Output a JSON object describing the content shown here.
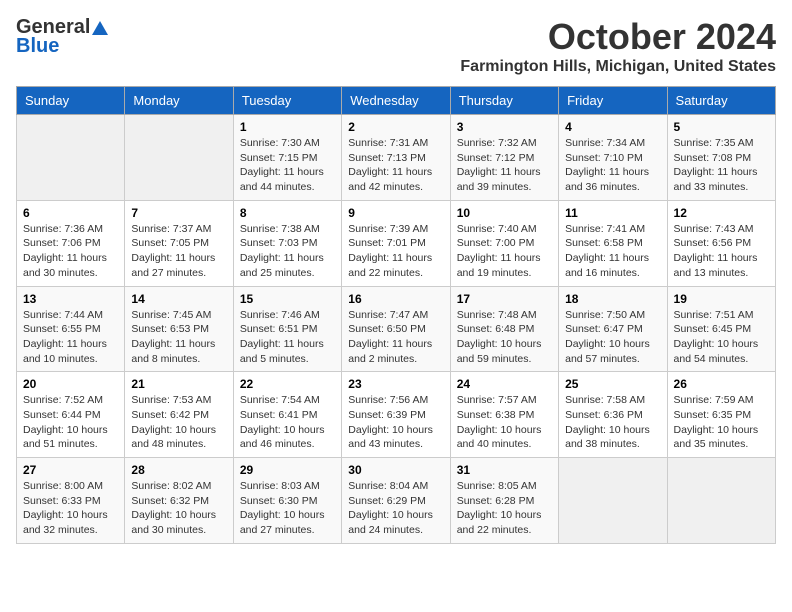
{
  "logo": {
    "general": "General",
    "blue": "Blue"
  },
  "title": "October 2024",
  "location": "Farmington Hills, Michigan, United States",
  "days_header": [
    "Sunday",
    "Monday",
    "Tuesday",
    "Wednesday",
    "Thursday",
    "Friday",
    "Saturday"
  ],
  "weeks": [
    [
      {
        "day": "",
        "info": ""
      },
      {
        "day": "",
        "info": ""
      },
      {
        "day": "1",
        "info": "Sunrise: 7:30 AM\nSunset: 7:15 PM\nDaylight: 11 hours and 44 minutes."
      },
      {
        "day": "2",
        "info": "Sunrise: 7:31 AM\nSunset: 7:13 PM\nDaylight: 11 hours and 42 minutes."
      },
      {
        "day": "3",
        "info": "Sunrise: 7:32 AM\nSunset: 7:12 PM\nDaylight: 11 hours and 39 minutes."
      },
      {
        "day": "4",
        "info": "Sunrise: 7:34 AM\nSunset: 7:10 PM\nDaylight: 11 hours and 36 minutes."
      },
      {
        "day": "5",
        "info": "Sunrise: 7:35 AM\nSunset: 7:08 PM\nDaylight: 11 hours and 33 minutes."
      }
    ],
    [
      {
        "day": "6",
        "info": "Sunrise: 7:36 AM\nSunset: 7:06 PM\nDaylight: 11 hours and 30 minutes."
      },
      {
        "day": "7",
        "info": "Sunrise: 7:37 AM\nSunset: 7:05 PM\nDaylight: 11 hours and 27 minutes."
      },
      {
        "day": "8",
        "info": "Sunrise: 7:38 AM\nSunset: 7:03 PM\nDaylight: 11 hours and 25 minutes."
      },
      {
        "day": "9",
        "info": "Sunrise: 7:39 AM\nSunset: 7:01 PM\nDaylight: 11 hours and 22 minutes."
      },
      {
        "day": "10",
        "info": "Sunrise: 7:40 AM\nSunset: 7:00 PM\nDaylight: 11 hours and 19 minutes."
      },
      {
        "day": "11",
        "info": "Sunrise: 7:41 AM\nSunset: 6:58 PM\nDaylight: 11 hours and 16 minutes."
      },
      {
        "day": "12",
        "info": "Sunrise: 7:43 AM\nSunset: 6:56 PM\nDaylight: 11 hours and 13 minutes."
      }
    ],
    [
      {
        "day": "13",
        "info": "Sunrise: 7:44 AM\nSunset: 6:55 PM\nDaylight: 11 hours and 10 minutes."
      },
      {
        "day": "14",
        "info": "Sunrise: 7:45 AM\nSunset: 6:53 PM\nDaylight: 11 hours and 8 minutes."
      },
      {
        "day": "15",
        "info": "Sunrise: 7:46 AM\nSunset: 6:51 PM\nDaylight: 11 hours and 5 minutes."
      },
      {
        "day": "16",
        "info": "Sunrise: 7:47 AM\nSunset: 6:50 PM\nDaylight: 11 hours and 2 minutes."
      },
      {
        "day": "17",
        "info": "Sunrise: 7:48 AM\nSunset: 6:48 PM\nDaylight: 10 hours and 59 minutes."
      },
      {
        "day": "18",
        "info": "Sunrise: 7:50 AM\nSunset: 6:47 PM\nDaylight: 10 hours and 57 minutes."
      },
      {
        "day": "19",
        "info": "Sunrise: 7:51 AM\nSunset: 6:45 PM\nDaylight: 10 hours and 54 minutes."
      }
    ],
    [
      {
        "day": "20",
        "info": "Sunrise: 7:52 AM\nSunset: 6:44 PM\nDaylight: 10 hours and 51 minutes."
      },
      {
        "day": "21",
        "info": "Sunrise: 7:53 AM\nSunset: 6:42 PM\nDaylight: 10 hours and 48 minutes."
      },
      {
        "day": "22",
        "info": "Sunrise: 7:54 AM\nSunset: 6:41 PM\nDaylight: 10 hours and 46 minutes."
      },
      {
        "day": "23",
        "info": "Sunrise: 7:56 AM\nSunset: 6:39 PM\nDaylight: 10 hours and 43 minutes."
      },
      {
        "day": "24",
        "info": "Sunrise: 7:57 AM\nSunset: 6:38 PM\nDaylight: 10 hours and 40 minutes."
      },
      {
        "day": "25",
        "info": "Sunrise: 7:58 AM\nSunset: 6:36 PM\nDaylight: 10 hours and 38 minutes."
      },
      {
        "day": "26",
        "info": "Sunrise: 7:59 AM\nSunset: 6:35 PM\nDaylight: 10 hours and 35 minutes."
      }
    ],
    [
      {
        "day": "27",
        "info": "Sunrise: 8:00 AM\nSunset: 6:33 PM\nDaylight: 10 hours and 32 minutes."
      },
      {
        "day": "28",
        "info": "Sunrise: 8:02 AM\nSunset: 6:32 PM\nDaylight: 10 hours and 30 minutes."
      },
      {
        "day": "29",
        "info": "Sunrise: 8:03 AM\nSunset: 6:30 PM\nDaylight: 10 hours and 27 minutes."
      },
      {
        "day": "30",
        "info": "Sunrise: 8:04 AM\nSunset: 6:29 PM\nDaylight: 10 hours and 24 minutes."
      },
      {
        "day": "31",
        "info": "Sunrise: 8:05 AM\nSunset: 6:28 PM\nDaylight: 10 hours and 22 minutes."
      },
      {
        "day": "",
        "info": ""
      },
      {
        "day": "",
        "info": ""
      }
    ]
  ]
}
